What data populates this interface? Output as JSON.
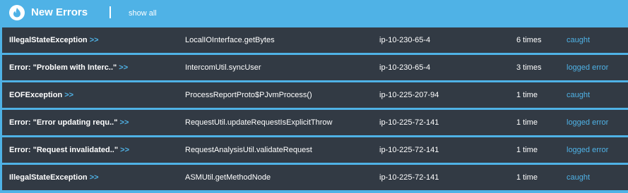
{
  "header": {
    "title": "New Errors",
    "separator": "|",
    "show_all": "show all"
  },
  "colors": {
    "header_bg": "#4fb2e6",
    "row_bg": "#323a44",
    "accent": "#4fb2e6",
    "text": "#ffffff"
  },
  "rows": [
    {
      "error": "IllegalStateException",
      "arrow": ">>",
      "method": "LocalIOInterface.getBytes",
      "host": "ip-10-230-65-4",
      "count": "6 times",
      "status": "caught"
    },
    {
      "error": "Error: \"Problem with Interc..\"",
      "arrow": ">>",
      "method": "IntercomUtil.syncUser",
      "host": "ip-10-230-65-4",
      "count": "3 times",
      "status": "logged error"
    },
    {
      "error": "EOFException",
      "arrow": ">>",
      "method": "ProcessReportProto$PJvmProcess()",
      "host": "ip-10-225-207-94",
      "count": "1 time",
      "status": "caught"
    },
    {
      "error": "Error: \"Error updating requ..\"",
      "arrow": ">>",
      "method": "RequestUtil.updateRequestIsExplicitThrow",
      "host": "ip-10-225-72-141",
      "count": "1 time",
      "status": "logged error"
    },
    {
      "error": "Error: \"Request invalidated..\"",
      "arrow": ">>",
      "method": "RequestAnalysisUtil.validateRequest",
      "host": "ip-10-225-72-141",
      "count": "1 time",
      "status": "logged error"
    },
    {
      "error": "IllegalStateException",
      "arrow": ">>",
      "method": "ASMUtil.getMethodNode",
      "host": "ip-10-225-72-141",
      "count": "1 time",
      "status": "caught"
    }
  ]
}
